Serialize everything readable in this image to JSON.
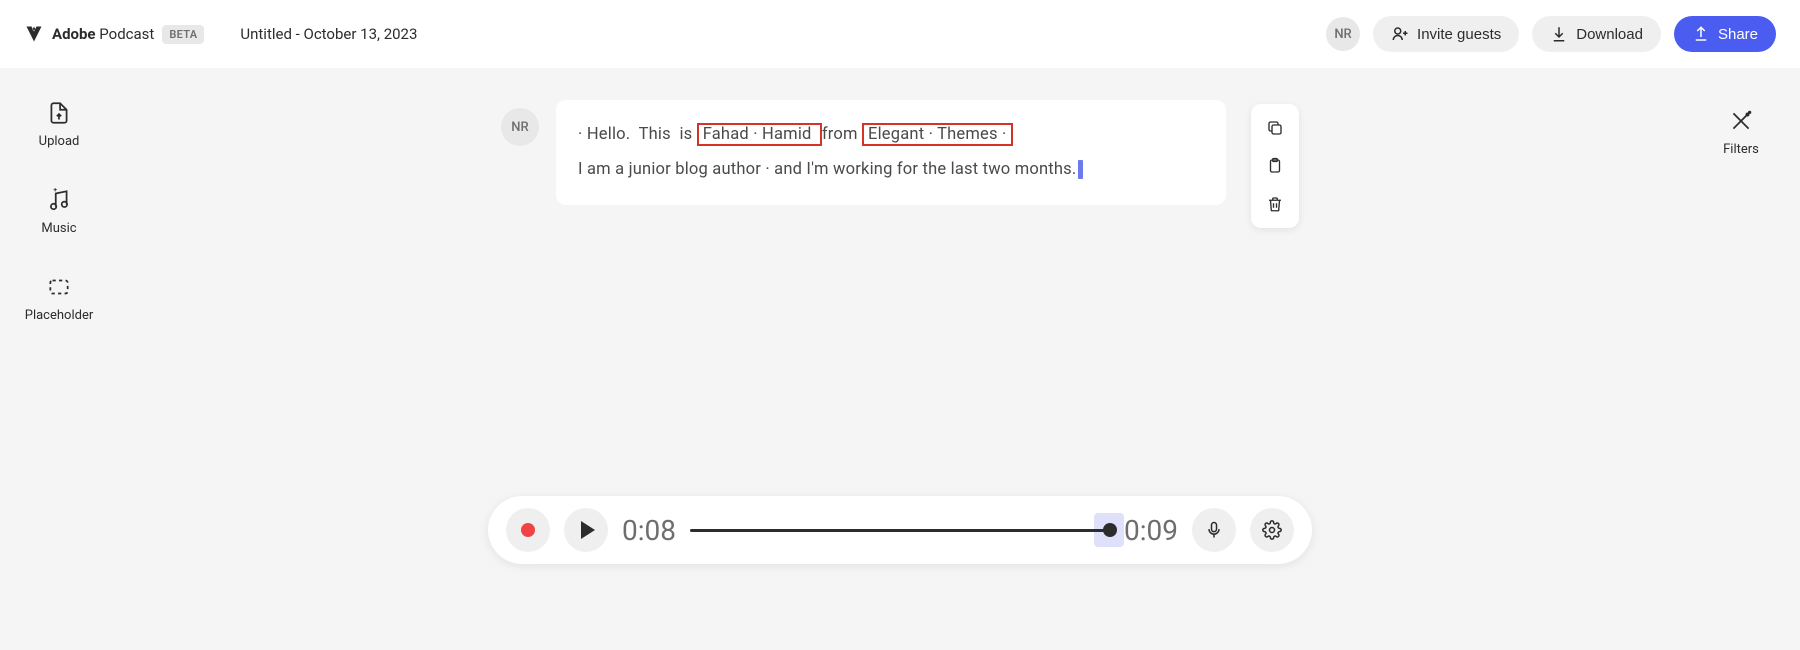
{
  "header": {
    "brand_bold": "Adobe",
    "brand_text": "Podcast",
    "beta": "BETA",
    "doc_title": "Untitled - October 13, 2023",
    "avatar_initials": "NR",
    "invite_label": "Invite guests",
    "download_label": "Download",
    "share_label": "Share"
  },
  "sidebar": {
    "items": [
      {
        "label": "Upload"
      },
      {
        "label": "Music"
      },
      {
        "label": "Placeholder"
      }
    ],
    "filters_label": "Filters"
  },
  "transcript": {
    "speaker_initials": "NR",
    "line1": {
      "dot0": "·",
      "w1": "Hello.",
      "w2": "This",
      "w3": "is",
      "hl1_a": "Fahad",
      "hl1_dot": "·",
      "hl1_b": "Hamid",
      "w4": "from",
      "hl2_a": "Elegant",
      "hl2_dot": "·",
      "hl2_b": "Themes",
      "dot_end": "·"
    },
    "line2": "I  am  a  junior  blog  author · and  I'm  working  for  the  last  two  months."
  },
  "player": {
    "time_current": "0:08",
    "time_total": "0:09"
  }
}
